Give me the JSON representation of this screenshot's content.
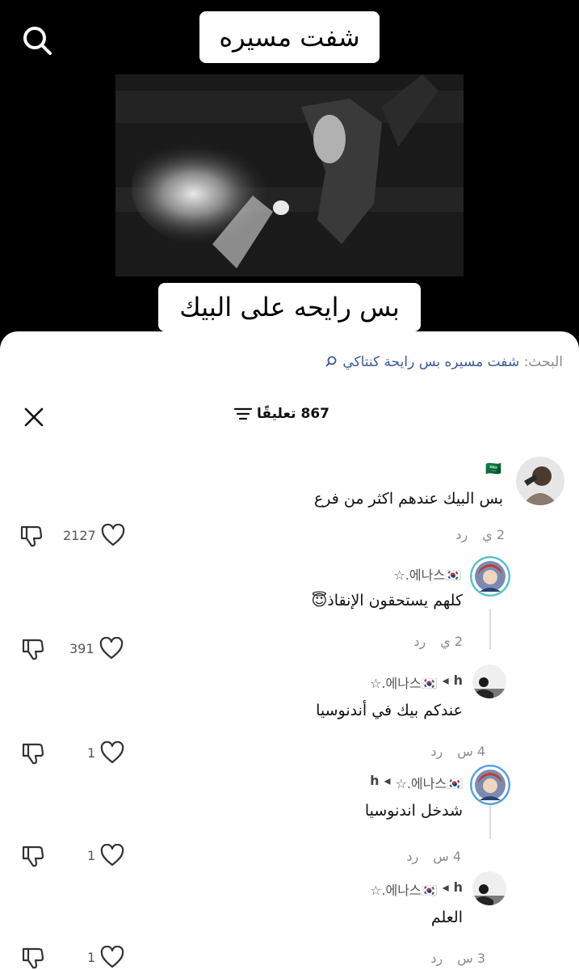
{
  "video": {
    "caption_top": "شفت مسيره",
    "caption_bottom": "بس رايحه على البيك"
  },
  "search_suggestion": {
    "label": "البحث:",
    "query": "شفت مسيره بس رايحة كنتاكي"
  },
  "comments_header": {
    "count": "867",
    "label": "تعليقًا"
  },
  "comments": [
    {
      "username_flag": "🇸🇦",
      "text": "بس البيك عندهم اكثر من فرع",
      "time": "2 ي",
      "reply": "رد",
      "likes": "2127"
    },
    {
      "username": "☆.에나스🇰🇷",
      "text": "كلهم يستحقون الإنقاذ😇",
      "time": "2 ي",
      "reply": "رد",
      "likes": "391"
    },
    {
      "username": "h",
      "reply_to": "☆.에나스🇰🇷",
      "text": "عندكم بيك في أندنوسيا",
      "time": "4 س",
      "reply": "رد",
      "likes": "1"
    },
    {
      "username": "☆.에나스🇰🇷",
      "reply_to": "h",
      "text": "شدخل اندنوسيا",
      "time": "4 س",
      "reply": "رد",
      "likes": "1"
    },
    {
      "username": "h",
      "reply_to": "☆.에나스🇰🇷",
      "text": "العلم",
      "time": "3 س",
      "reply": "رد",
      "likes": "1"
    }
  ],
  "colors": {
    "link": "#3b5a9b",
    "muted": "#8a8a8a",
    "sheet_bg": "#ffffff",
    "video_bg": "#000000"
  },
  "icons": {
    "search": "search-icon",
    "close": "close-icon",
    "filter": "filter-icon",
    "heart": "heart-icon",
    "dislike": "thumbs-down-icon"
  }
}
